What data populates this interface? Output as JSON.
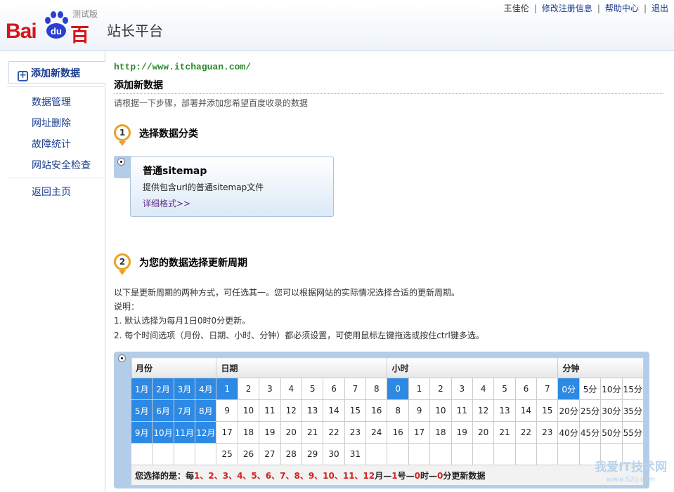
{
  "header": {
    "logo_text": "Bai du 百度",
    "logo_badge": "测试版",
    "site_title": "站长平台",
    "user": "王佳伦",
    "links": [
      "修改注册信息",
      "帮助中心",
      "退出"
    ]
  },
  "sidebar": {
    "active": "添加新数据",
    "items": [
      "数据管理",
      "网址删除",
      "故障统计",
      "网站安全检查"
    ],
    "home": "返回主页"
  },
  "main": {
    "site_url": "http://www.itchaguan.com/",
    "title": "添加新数据",
    "intro": "请根据一下步骤，部署并添加您希望百度收录的数据",
    "step1": {
      "num": "1",
      "title": "选择数据分类",
      "card_title": "普通sitemap",
      "card_desc": "提供包含url的普通sitemap文件",
      "card_link": "详细格式>>"
    },
    "step2": {
      "num": "2",
      "title": "为您的数据选择更新周期",
      "lines": [
        "以下是更新周期的两种方式，可任选其一。您可以根据网站的实际情况选择合适的更新周期。",
        "说明：",
        "1. 默认选择为每月1日0时0分更新。",
        "2. 每个时间选项（月份、日期、小时、分钟）都必须设置，可使用鼠标左键拖选或按住ctrl键多选。"
      ]
    }
  },
  "period": {
    "headers": [
      "月份",
      "日期",
      "小时",
      "分钟"
    ],
    "months": [
      [
        "1月",
        "2月",
        "3月",
        "4月"
      ],
      [
        "5月",
        "6月",
        "7月",
        "8月"
      ],
      [
        "9月",
        "10月",
        "11月",
        "12月"
      ],
      [
        "",
        "",
        "",
        ""
      ]
    ],
    "days": [
      [
        "1",
        "2",
        "3",
        "4",
        "5",
        "6",
        "7",
        "8"
      ],
      [
        "9",
        "10",
        "11",
        "12",
        "13",
        "14",
        "15",
        "16"
      ],
      [
        "17",
        "18",
        "19",
        "20",
        "21",
        "22",
        "23",
        "24"
      ],
      [
        "25",
        "26",
        "27",
        "28",
        "29",
        "30",
        "31",
        ""
      ]
    ],
    "hours": [
      [
        "0",
        "1",
        "2",
        "3",
        "4",
        "5",
        "6",
        "7"
      ],
      [
        "8",
        "9",
        "10",
        "11",
        "12",
        "13",
        "14",
        "15"
      ],
      [
        "16",
        "17",
        "18",
        "19",
        "20",
        "21",
        "22",
        "23"
      ],
      [
        "",
        "",
        "",
        "",
        "",
        "",
        "",
        ""
      ]
    ],
    "minutes": [
      [
        "0分",
        "5分",
        "10分",
        "15分"
      ],
      [
        "20分",
        "25分",
        "30分",
        "35分"
      ],
      [
        "40分",
        "45分",
        "50分",
        "55分"
      ],
      [
        "",
        "",
        "",
        ""
      ]
    ],
    "selected": {
      "months": [
        "1月",
        "2月",
        "3月",
        "4月",
        "5月",
        "6月",
        "7月",
        "8月",
        "9月",
        "10月",
        "11月",
        "12月"
      ],
      "days": [
        "1"
      ],
      "hours": [
        "0"
      ],
      "minutes": [
        "0分"
      ]
    },
    "summary": {
      "prefix": "您选择的是：每",
      "months": "1、2、3、4、5、6、7、8、9、10、11、12",
      "m_suffix": "月—",
      "day": "1",
      "d_suffix": "号—",
      "hour": "0",
      "h_suffix": "时—",
      "minute": "0",
      "tail": "分更新数据"
    }
  },
  "watermark": {
    "name": "我爱IT技术网",
    "url": "www.52ij.com"
  },
  "colors": {
    "selected": "#2d89e3",
    "accent": "#e9a224",
    "link": "#1a3c8e"
  }
}
